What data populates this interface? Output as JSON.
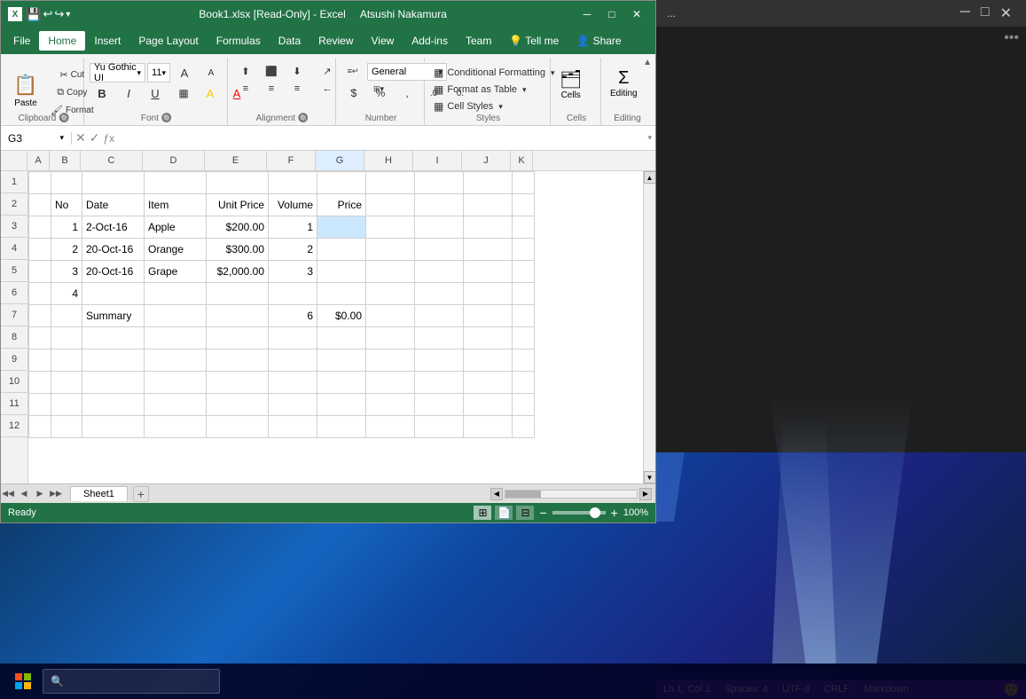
{
  "desktop": {
    "background_description": "Windows 10 blue gradient desktop"
  },
  "excel": {
    "title_bar": {
      "app_icon": "X",
      "filename": "Book1.xlsx [Read-Only] - Excel",
      "user": "Atsushi Nakamura",
      "minimize": "─",
      "restore": "□",
      "close": "✕"
    },
    "menu_bar": {
      "items": [
        "File",
        "Home",
        "Insert",
        "Page Layout",
        "Formulas",
        "Data",
        "Review",
        "View",
        "Add-ins",
        "Team",
        "Tell me",
        "Share"
      ]
    },
    "ribbon": {
      "clipboard_group": {
        "label": "Clipboard",
        "paste_label": "Paste",
        "cut_label": "Cut",
        "copy_label": "Copy",
        "format_painter_label": "Format Painter"
      },
      "font_group": {
        "label": "Font",
        "font_name": "Yu Gothic UI",
        "font_size": "11",
        "bold": "B",
        "italic": "I",
        "underline": "U",
        "border_icon": "▦",
        "fill_icon": "A",
        "font_color_icon": "A"
      },
      "alignment_group": {
        "label": "Alignment",
        "wrap_text": "Wrap Text",
        "merge_center": "Merge & Center"
      },
      "number_group": {
        "label": "Number",
        "format": "General",
        "percent": "%",
        "comma": ",",
        "increase_decimal": ".0→",
        "decrease_decimal": "←.0"
      },
      "styles_group": {
        "label": "Styles",
        "conditional_formatting": "Conditional Formatting",
        "format_as_table": "Format as Table",
        "cell_styles": "Cell Styles"
      },
      "cells_group": {
        "label": "Cells",
        "cells_label": "Cells"
      },
      "editing_group": {
        "label": "Editing",
        "editing_label": "Editing"
      }
    },
    "formula_bar": {
      "cell_ref": "G3",
      "formula": ""
    },
    "grid": {
      "columns": [
        "A",
        "B",
        "C",
        "D",
        "E",
        "F",
        "G",
        "H",
        "I",
        "J",
        "K"
      ],
      "rows": [
        1,
        2,
        3,
        4,
        5,
        6,
        7,
        8,
        9,
        10,
        11,
        12
      ],
      "data": {
        "B2": "No",
        "C2": "Date",
        "D2": "Item",
        "E2": "Unit Price",
        "F2": "Volume",
        "G2": "Price",
        "B3": "1",
        "C3": "2-Oct-16",
        "D3": "Apple",
        "E3": "$200.00",
        "F3": "1",
        "B4": "2",
        "C4": "20-Oct-16",
        "D4": "Orange",
        "E4": "$300.00",
        "F4": "2",
        "B5": "3",
        "C5": "20-Oct-16",
        "D5": "Grape",
        "E5": "$2,000.00",
        "F5": "3",
        "B6": "4",
        "C7": "Summary",
        "F7": "6",
        "G7": "$0.00"
      }
    },
    "sheet_tabs": {
      "sheets": [
        "Sheet1"
      ],
      "add_label": "+"
    },
    "status_bar": {
      "text": "Ready",
      "zoom": "100%"
    }
  },
  "vscode": {
    "title": "...",
    "statusbar": {
      "position": "Ln 1, Col 1",
      "spaces": "Spaces: 4",
      "encoding": "UTF-8",
      "line_ending": "CRLF",
      "language": "Markdown",
      "smiley": "🙂"
    }
  }
}
